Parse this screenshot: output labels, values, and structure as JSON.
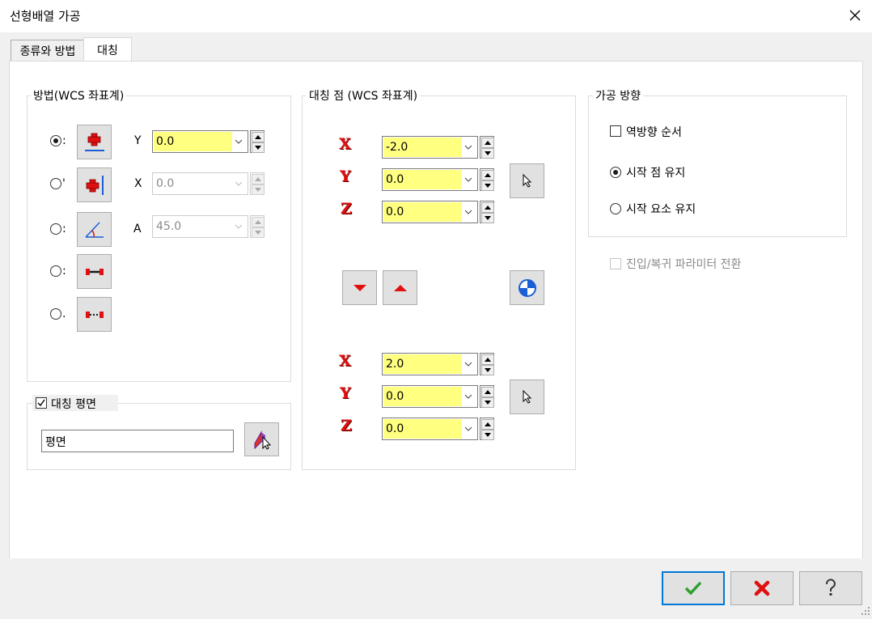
{
  "window": {
    "title": "선형배열 가공"
  },
  "tabs": [
    {
      "label": "종류와 방법",
      "active": false
    },
    {
      "label": "대칭",
      "active": true
    }
  ],
  "method_group": {
    "title": "방법(WCS 좌표계)",
    "radio_stubs": [
      ":",
      "'",
      ":",
      ":",
      "."
    ],
    "selected_index": 0,
    "fields": [
      {
        "label": "Y",
        "value": "0.0",
        "enabled": true
      },
      {
        "label": "X",
        "value": "0.0",
        "enabled": false
      },
      {
        "label": "A",
        "value": "45.0",
        "enabled": false
      }
    ]
  },
  "symmetry_plane": {
    "label": "대칭 평면",
    "checked": true,
    "entity_value": "평면"
  },
  "symmetry_point": {
    "title": "대칭 점 (WCS 좌표계)",
    "point1": [
      {
        "axis": "X",
        "value": "-2.0"
      },
      {
        "axis": "Y",
        "value": "0.0"
      },
      {
        "axis": "Z",
        "value": "0.0"
      }
    ],
    "point2": [
      {
        "axis": "X",
        "value": "2.0"
      },
      {
        "axis": "Y",
        "value": "0.0"
      },
      {
        "axis": "Z",
        "value": "0.0"
      }
    ]
  },
  "direction_group": {
    "title": "가공 방향",
    "reverse_order": {
      "label": "역방향 순서",
      "checked": false
    },
    "options": [
      {
        "label": "시작 점 유지",
        "selected": true
      },
      {
        "label": "시작 요소 유지",
        "selected": false
      }
    ]
  },
  "param_switch": {
    "label": "진입/복귀 파라미터 전환",
    "checked": false,
    "enabled": false
  },
  "colors": {
    "field_highlight": "#ffff80",
    "icon_red": "#e01010",
    "icon_blue": "#1a5fd6",
    "ok_green": "#2ea02e"
  },
  "icons": [
    "close-icon",
    "ok-check-icon",
    "cancel-x-icon",
    "help-question-icon",
    "pick-arrow-icon",
    "pick-plane-icon"
  ]
}
